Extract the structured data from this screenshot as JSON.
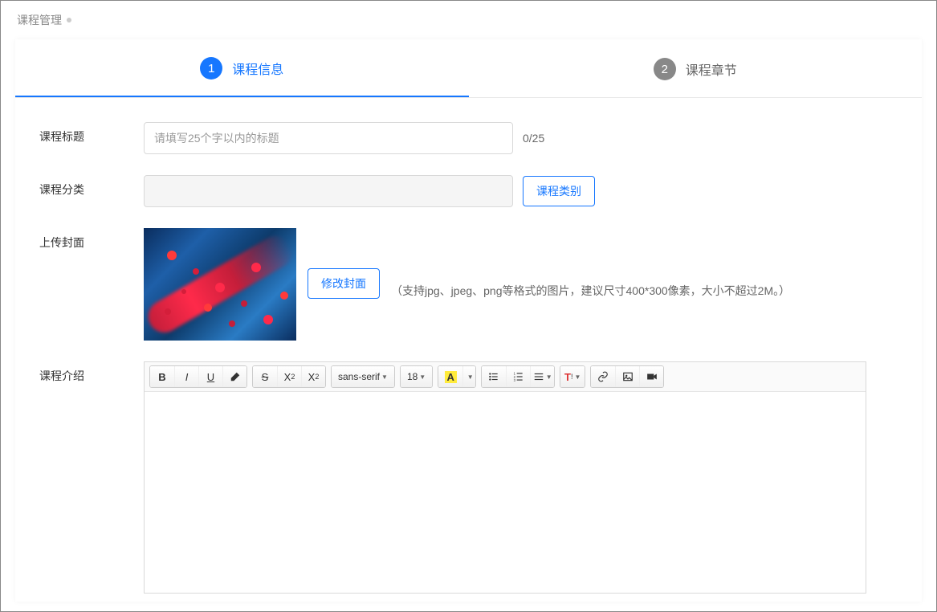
{
  "pageTitle": "课程管理",
  "tabs": [
    {
      "num": "1",
      "label": "课程信息",
      "active": true
    },
    {
      "num": "2",
      "label": "课程章节",
      "active": false
    }
  ],
  "form": {
    "titleLabel": "课程标题",
    "titlePlaceholder": "请填写25个字以内的标题",
    "titleCount": "0/25",
    "categoryLabel": "课程分类",
    "categoryBtn": "课程类别",
    "coverLabel": "上传封面",
    "coverBtn": "修改封面",
    "coverHint": "（支持jpg、jpeg、png等格式的图片，建议尺寸400*300像素，大小不超过2M。）",
    "introLabel": "课程介绍"
  },
  "editor": {
    "fontFamily": "sans-serif",
    "fontSize": "18"
  }
}
